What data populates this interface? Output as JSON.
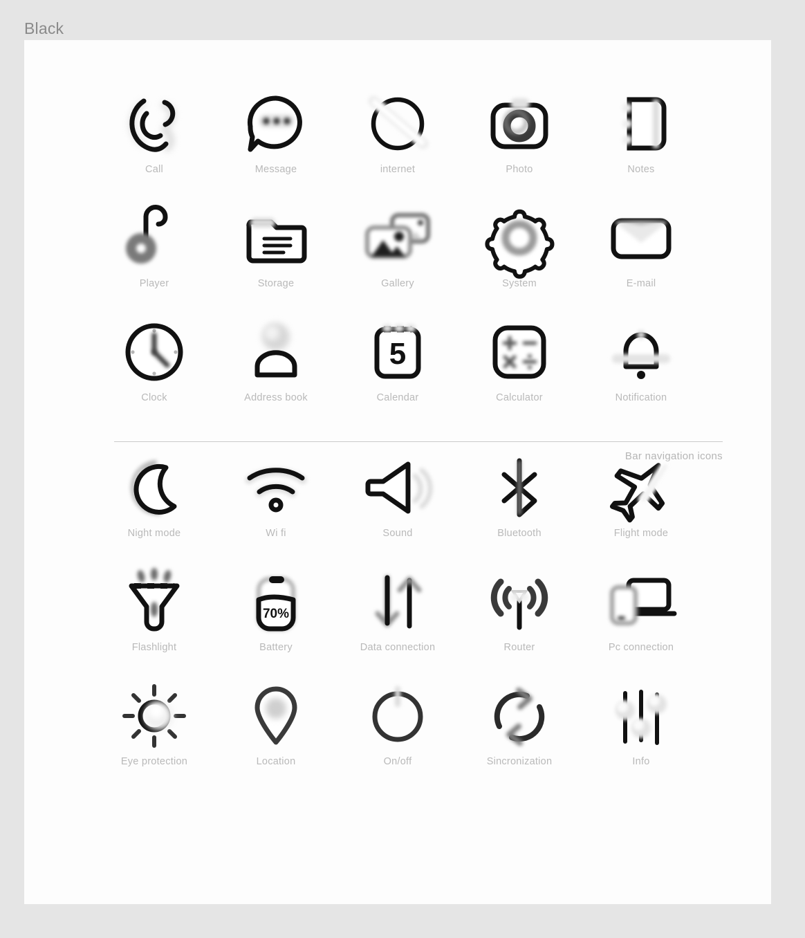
{
  "header": {
    "title": "Black"
  },
  "section_divider": {
    "label": "Bar navigation icons"
  },
  "colors": {
    "background": "#e5e5e5",
    "panel": "#fdfdfd",
    "title_text": "#8a8a8a",
    "caption_text": "#b9b9b9",
    "divider": "#c9c9c9",
    "icon_stroke": "#111111",
    "icon_highlight": "#d9d9d9"
  },
  "sections": [
    {
      "name": "app-icons",
      "icons": [
        {
          "label": "Call",
          "icon": "phone-call-icon"
        },
        {
          "label": "Message",
          "icon": "chat-bubble-icon"
        },
        {
          "label": "internet",
          "icon": "globe-slash-icon"
        },
        {
          "label": "Photo",
          "icon": "camera-icon"
        },
        {
          "label": "Notes",
          "icon": "notebook-icon"
        },
        {
          "label": "Player",
          "icon": "music-note-icon"
        },
        {
          "label": "Storage",
          "icon": "folder-icon"
        },
        {
          "label": "Gallery",
          "icon": "photo-stack-icon"
        },
        {
          "label": "System",
          "icon": "gear-icon"
        },
        {
          "label": "E-mail",
          "icon": "envelope-icon"
        },
        {
          "label": "Clock",
          "icon": "clock-icon"
        },
        {
          "label": "Address book",
          "icon": "person-icon"
        },
        {
          "label": "Calendar",
          "icon": "calendar-icon",
          "value": "5"
        },
        {
          "label": "Calculator",
          "icon": "calculator-icon"
        },
        {
          "label": "Notification",
          "icon": "bell-icon"
        }
      ]
    },
    {
      "name": "bar-navigation-icons",
      "icons": [
        {
          "label": "Night mode",
          "icon": "moon-icon"
        },
        {
          "label": "Wi fi",
          "icon": "wifi-icon"
        },
        {
          "label": "Sound",
          "icon": "speaker-icon"
        },
        {
          "label": "Bluetooth",
          "icon": "bluetooth-icon"
        },
        {
          "label": "Flight mode",
          "icon": "airplane-icon"
        },
        {
          "label": "Flashlight",
          "icon": "flashlight-icon"
        },
        {
          "label": "Battery",
          "icon": "battery-icon",
          "value": "70%"
        },
        {
          "label": "Data connection",
          "icon": "up-down-arrows-icon"
        },
        {
          "label": "Router",
          "icon": "antenna-icon"
        },
        {
          "label": "Pc connection",
          "icon": "laptop-phone-icon"
        },
        {
          "label": "Eye protection",
          "icon": "sun-icon"
        },
        {
          "label": "Location",
          "icon": "map-pin-icon"
        },
        {
          "label": "On/off",
          "icon": "power-icon"
        },
        {
          "label": "Sincronization",
          "icon": "sync-arrows-icon"
        },
        {
          "label": "Info",
          "icon": "sliders-icon"
        }
      ]
    }
  ]
}
